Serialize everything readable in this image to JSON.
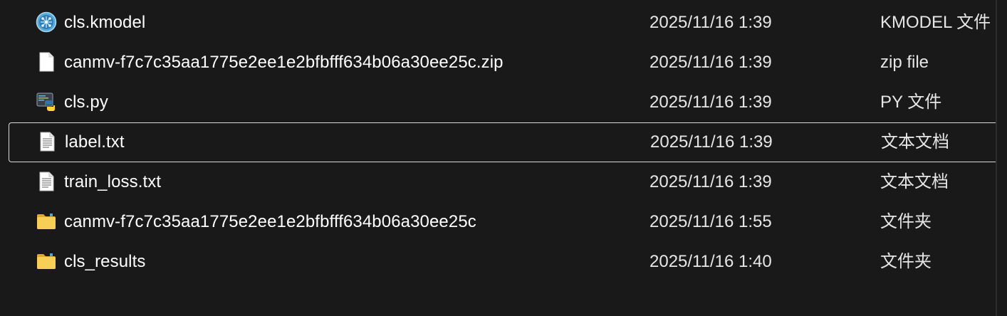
{
  "files": [
    {
      "name": "cls.kmodel",
      "date": "2025/11/16 1:39",
      "type": "KMODEL 文件",
      "icon": "kmodel-file-icon",
      "selected": false
    },
    {
      "name": "canmv-f7c7c35aa1775e2ee1e2bfbfff634b06a30ee25c.zip",
      "date": "2025/11/16 1:39",
      "type": "zip file",
      "icon": "blank-file-icon",
      "selected": false
    },
    {
      "name": "cls.py",
      "date": "2025/11/16 1:39",
      "type": "PY 文件",
      "icon": "python-file-icon",
      "selected": false
    },
    {
      "name": "label.txt",
      "date": "2025/11/16 1:39",
      "type": "文本文档",
      "icon": "text-file-icon",
      "selected": true
    },
    {
      "name": "train_loss.txt",
      "date": "2025/11/16 1:39",
      "type": "文本文档",
      "icon": "text-file-icon",
      "selected": false
    },
    {
      "name": "canmv-f7c7c35aa1775e2ee1e2bfbfff634b06a30ee25c",
      "date": "2025/11/16 1:55",
      "type": "文件夹",
      "icon": "folder-icon",
      "selected": false
    },
    {
      "name": "cls_results",
      "date": "2025/11/16 1:40",
      "type": "文件夹",
      "icon": "folder-icon",
      "selected": false
    }
  ],
  "colors": {
    "background": "#191919",
    "selection_border": "#d9d9d9",
    "folder": "#f5c542",
    "python_blue": "#3572a5",
    "python_yellow": "#ffd43b"
  }
}
